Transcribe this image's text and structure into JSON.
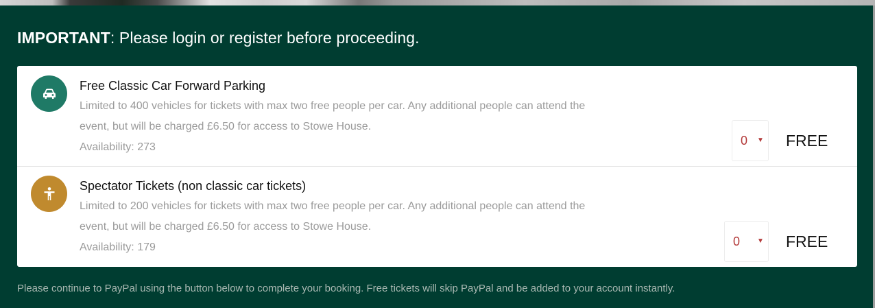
{
  "notice": {
    "label": "IMPORTANT",
    "text": ": Please login or register before proceeding."
  },
  "tickets": [
    {
      "icon": "car-icon",
      "icon_color": "#1f7a66",
      "title": "Free Classic Car Forward Parking",
      "description": "Limited to 400 vehicles for tickets with max two free people per car. Any additional people can attend the event, but will be charged £6.50 for access to Stowe House.",
      "availability": "Availability: 273",
      "quantity": "0",
      "price": "FREE"
    },
    {
      "icon": "person-icon",
      "icon_color": "#c08a2e",
      "title": "Spectator Tickets (non classic car tickets)",
      "description": "Limited to 200 vehicles for tickets with max two free people per car. Any additional people can attend the event, but will be charged £6.50 for access to Stowe House.",
      "availability": "Availability: 179",
      "quantity": "0",
      "price": "FREE"
    }
  ],
  "footer": {
    "note": "Please continue to PayPal using the button below to complete your booking. Free tickets will skip PayPal and be added to your account instantly."
  },
  "colors": {
    "background": "#003d31",
    "accent_red": "#b33a3a"
  }
}
